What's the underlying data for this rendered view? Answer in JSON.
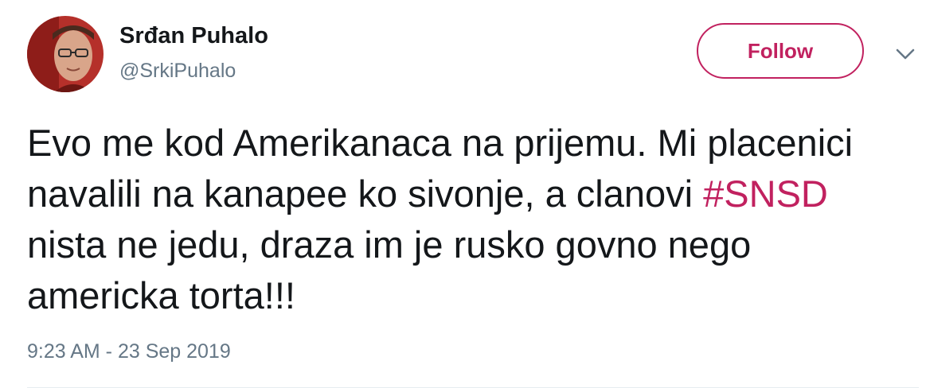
{
  "author": {
    "display_name": "Srđan Puhalo",
    "handle": "@SrkiPuhalo"
  },
  "follow_button": {
    "label": "Follow"
  },
  "caret": {
    "icon": "chevron-down-icon"
  },
  "tweet": {
    "segments": [
      "Evo me kod Amerikanaca na prijemu. Mi placenici navalili na kanapee ko sivonje, a clanovi ",
      "#SNSD",
      " nista ne jedu, draza im je rusko govno nego americka torta!!!"
    ],
    "timestamp": "9:23 AM - 23 Sep 2019"
  },
  "colors": {
    "accent": "#c1215f",
    "text": "#14171a",
    "secondary_text": "#657786",
    "divider": "#e6ecf0"
  }
}
